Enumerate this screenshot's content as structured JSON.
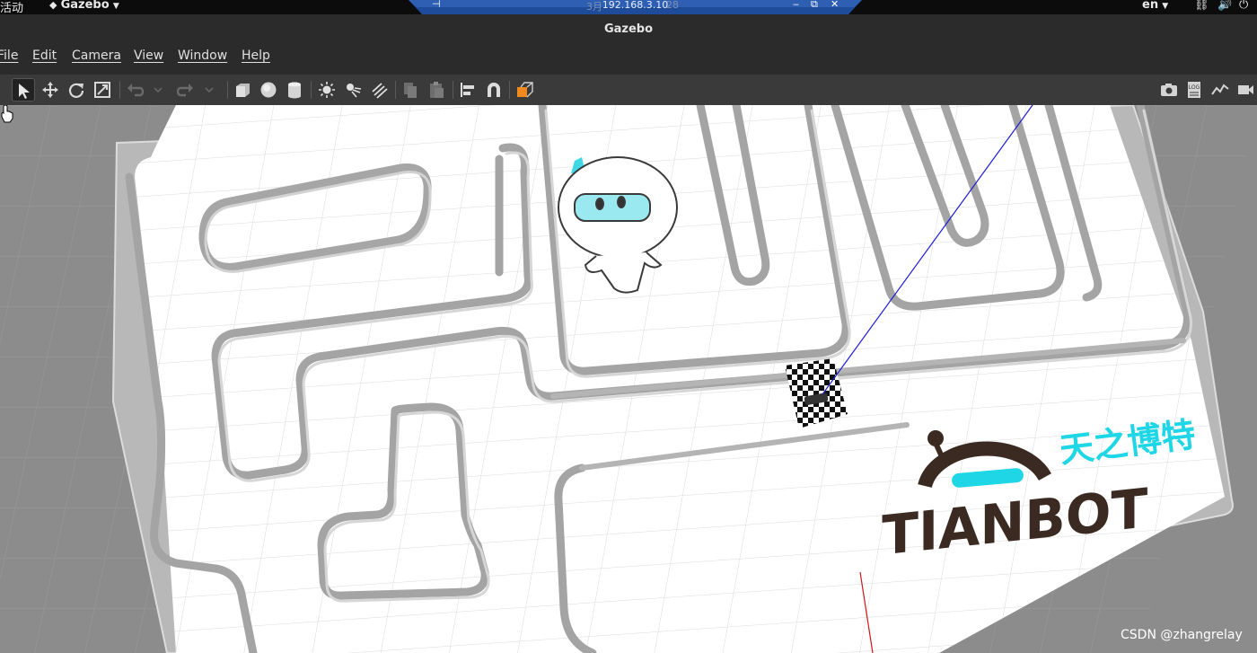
{
  "system_bar": {
    "activities": "活动",
    "app_menu": "Gazebo",
    "vnc_ip": "192.168.3.10",
    "vnc_ghost_left": "3月",
    "vnc_ghost_right": "28",
    "language": "en"
  },
  "window": {
    "title": "Gazebo"
  },
  "menu": {
    "items": [
      {
        "label": "File"
      },
      {
        "label": "Edit"
      },
      {
        "label": "Camera"
      },
      {
        "label": "View"
      },
      {
        "label": "Window"
      },
      {
        "label": "Help"
      }
    ]
  },
  "toolbar": {
    "left_icons": [
      "select-mode-icon",
      "translate-mode-icon",
      "rotate-mode-icon",
      "scale-mode-icon",
      "undo-icon",
      "undo-dropdown-icon",
      "redo-icon",
      "redo-dropdown-icon",
      "box-shape-icon",
      "sphere-shape-icon",
      "cylinder-shape-icon",
      "point-light-icon",
      "spot-light-icon",
      "directional-light-icon",
      "copy-icon",
      "paste-icon",
      "align-icon",
      "snap-icon",
      "change-view-icon"
    ],
    "right_icons": [
      "screenshot-icon",
      "log-icon",
      "plot-icon",
      "video-record-icon"
    ],
    "accent_color": "#f08a1e"
  },
  "scene": {
    "logo_text": "TIANBOT",
    "logo_cn": "天之博特",
    "logo_color": "#3b2a22",
    "logo_accent": "#1ed6e6"
  },
  "watermark": "CSDN @zhangrelay"
}
